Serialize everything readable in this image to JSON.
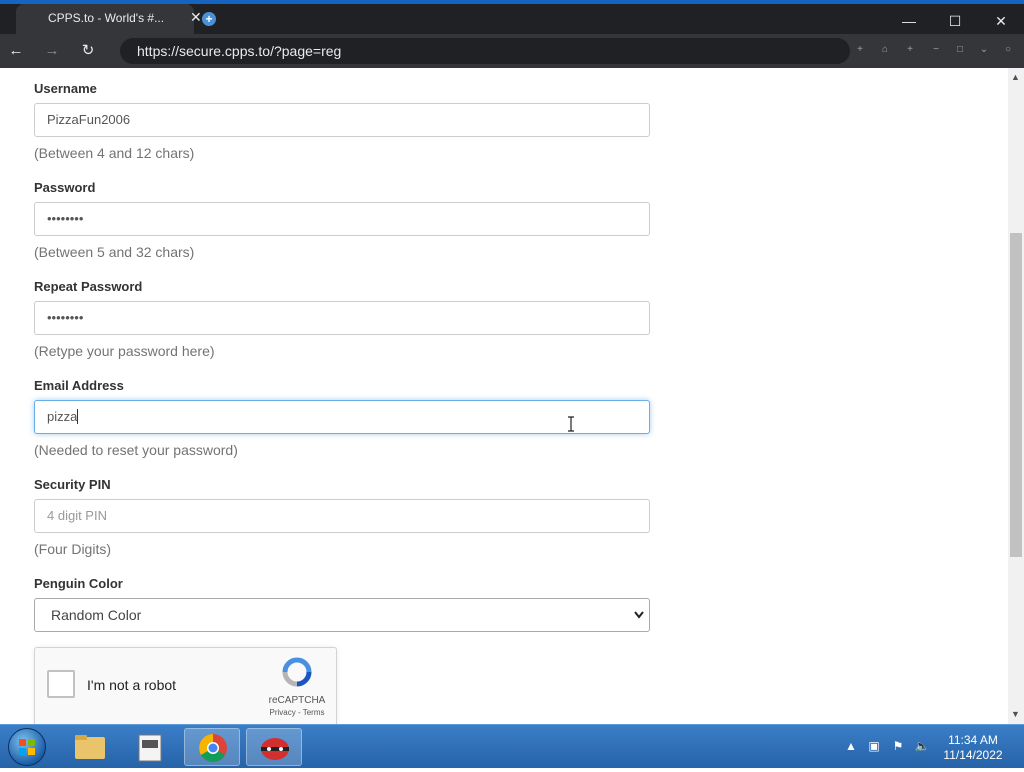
{
  "browser": {
    "tab_title": "CPPS.to - World's #...",
    "url": "https://secure.cpps.to/?page=reg",
    "new_tab_symbol": "+"
  },
  "form": {
    "username": {
      "label": "Username",
      "value": "PizzaFun2006",
      "help": "(Between 4 and 12 chars)"
    },
    "password": {
      "label": "Password",
      "value": "••••••••",
      "help": "(Between 5 and 32 chars)"
    },
    "repeat_password": {
      "label": "Repeat Password",
      "value": "••••••••",
      "help": "(Retype your password here)"
    },
    "email": {
      "label": "Email Address",
      "value": "pizza",
      "help": "(Needed to reset your password)"
    },
    "pin": {
      "label": "Security PIN",
      "value": "",
      "placeholder": "4 digit PIN",
      "help": "(Four Digits)"
    },
    "color": {
      "label": "Penguin Color",
      "selected": "Random Color"
    }
  },
  "recaptcha": {
    "checkbox_label": "I'm not a robot",
    "brand": "reCAPTCHA",
    "links": "Privacy - Terms"
  },
  "taskbar": {
    "time": "11:34 AM",
    "date": "11/14/2022"
  },
  "colors": {
    "chrome_dark": "#202124",
    "chrome_toolbar": "#35363a",
    "focus_blue": "#66afe9",
    "taskbar_blue": "#2763a8"
  }
}
